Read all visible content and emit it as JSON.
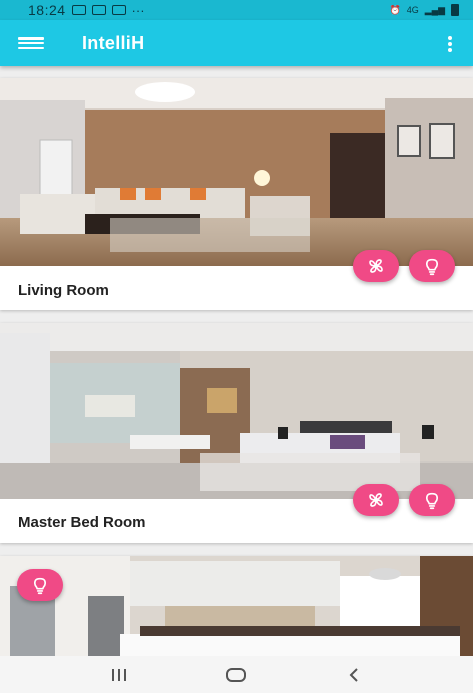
{
  "status_bar": {
    "time": "18:24",
    "dots": "···",
    "network": "4G"
  },
  "app_bar": {
    "title": "IntelliH"
  },
  "rooms": [
    {
      "name": "Living Room",
      "actions": [
        "fan-icon",
        "lightbulb-icon"
      ]
    },
    {
      "name": "Master Bed Room",
      "actions": [
        "fan-icon",
        "lightbulb-icon"
      ]
    },
    {
      "name": "",
      "actions": [
        "lightbulb-icon"
      ]
    }
  ],
  "nav_bar": {
    "buttons": [
      "recents",
      "home",
      "back"
    ]
  },
  "colors": {
    "status_bar": "#1ab8d0",
    "app_bar": "#1ec8e4",
    "fab": "#f04a86"
  }
}
